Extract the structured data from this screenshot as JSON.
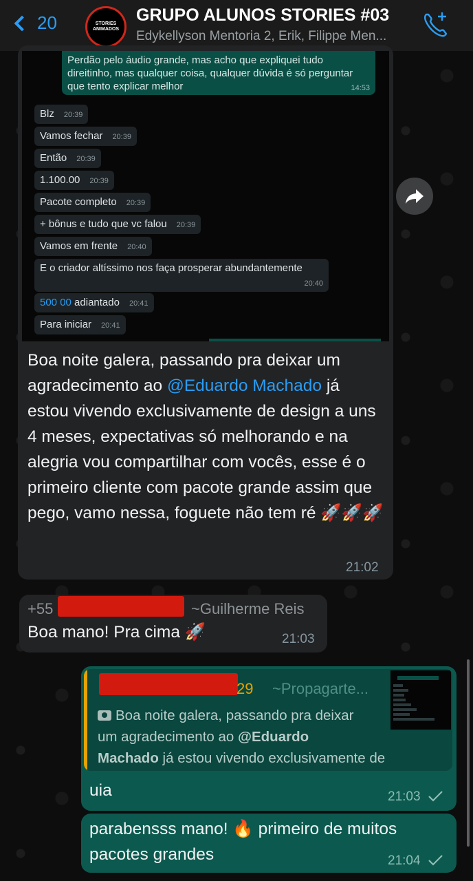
{
  "header": {
    "back_count": "20",
    "group_name": "GRUPO ALUNOS STORIES #03",
    "participants": "Edykellyson Mentoria 2, Erik, Filippe Men...",
    "avatar_text_1": "STORIES",
    "avatar_text_2": "ANIMADOS"
  },
  "screenshot": {
    "top_message": "Perdão pelo áudio grande, mas acho que expliquei tudo direitinho, mas qualquer coisa, qualquer dúvida é só perguntar que tento explicar melhor",
    "top_time": "14:53",
    "messages": [
      {
        "text": "Blz",
        "time": "20:39"
      },
      {
        "text": "Vamos fechar",
        "time": "20:39"
      },
      {
        "text": "Então",
        "time": "20:39"
      },
      {
        "text": "1.100.00",
        "time": "20:39"
      },
      {
        "text": "Pacote completo",
        "time": "20:39"
      },
      {
        "text": "+ bônus e tudo que vc falou",
        "time": "20:39"
      },
      {
        "text": "Vamos em frente",
        "time": "20:40"
      },
      {
        "text": "E o criador altíssimo nos faça prosperar abundantemente",
        "time": "20:40"
      },
      {
        "text_hl": "500 00",
        "text": " adiantado",
        "time": "20:41"
      },
      {
        "text": "Para iniciar",
        "time": "20:41"
      }
    ]
  },
  "message1": {
    "text_before": "Boa noite galera, passando pra deixar um agradecimento ao ",
    "mention": "@Eduardo Machado",
    "text_after": " já estou vivendo exclusivamente de design a uns 4 meses, expectativas só melhorando e na alegria vou compartilhar com vocês, esse é o primeiro cliente com pacote grande assim que pego, vamo nessa, foguete não tem ré 🚀🚀🚀",
    "time": "21:02"
  },
  "message2": {
    "sender_prefix": "+55",
    "sender_name": "~Guilherme Reis",
    "text": "Boa mano! Pra cima 🚀",
    "time": "21:03"
  },
  "reply": {
    "quoted_suffix": "29",
    "quoted_name": "~Propagarte...",
    "quoted_text_1": "Boa noite galera, passando pra deixar",
    "quoted_text_2": "um agradecimento ao ",
    "quoted_mention_1": "@Eduardo",
    "quoted_mention_2": "Machado",
    "quoted_text_3": " já estou vivendo exclusivamente de de...",
    "text": "uia",
    "time": "21:03"
  },
  "message4": {
    "text": "parabensss mano! 🔥 primeiro de muitos pacotes grandes",
    "time": "21:04"
  },
  "colors": {
    "accent": "#2a9df4",
    "incoming_bubble": "#222325",
    "outgoing_bubble": "#0c5a4f",
    "redaction": "#d21a0f"
  }
}
